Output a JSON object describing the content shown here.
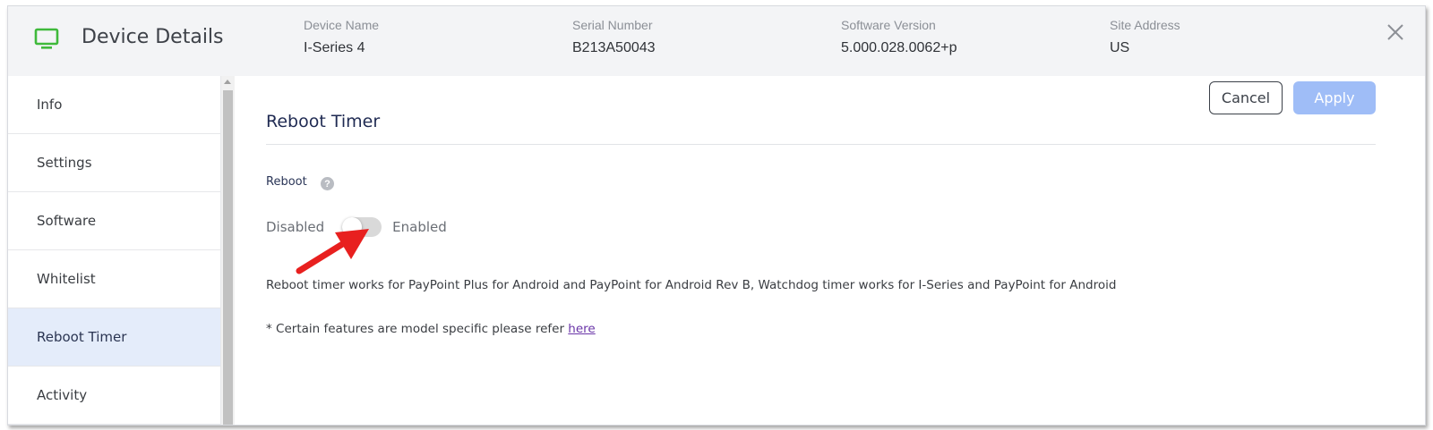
{
  "header": {
    "title": "Device Details",
    "fields": [
      {
        "label": "Device Name",
        "value": "I-Series 4"
      },
      {
        "label": "Serial Number",
        "value": "B213A50043"
      },
      {
        "label": "Software Version",
        "value": "5.000.028.0062+p"
      },
      {
        "label": "Site Address",
        "value": "US"
      }
    ],
    "icon": "monitor-icon",
    "icon_color": "#3fb93b"
  },
  "sidebar": {
    "items": [
      {
        "label": "Info"
      },
      {
        "label": "Settings"
      },
      {
        "label": "Software"
      },
      {
        "label": "Whitelist"
      },
      {
        "label": "Reboot Timer",
        "active": true
      },
      {
        "label": "Activity"
      }
    ]
  },
  "actions": {
    "cancel_label": "Cancel",
    "apply_label": "Apply",
    "apply_color": "#9fbdf7"
  },
  "main": {
    "section_title": "Reboot Timer",
    "field_label": "Reboot",
    "help_glyph": "?",
    "toggle": {
      "off_label": "Disabled",
      "on_label": "Enabled",
      "state": "off"
    },
    "description": "Reboot timer works for PayPoint Plus for Android and PayPoint for Android Rev B, Watchdog timer works for I-Series and PayPoint for Android",
    "note_prefix": "* Certain features are model specific please refer ",
    "note_link": "here"
  },
  "annotation": {
    "arrow_color": "#e8201f"
  }
}
